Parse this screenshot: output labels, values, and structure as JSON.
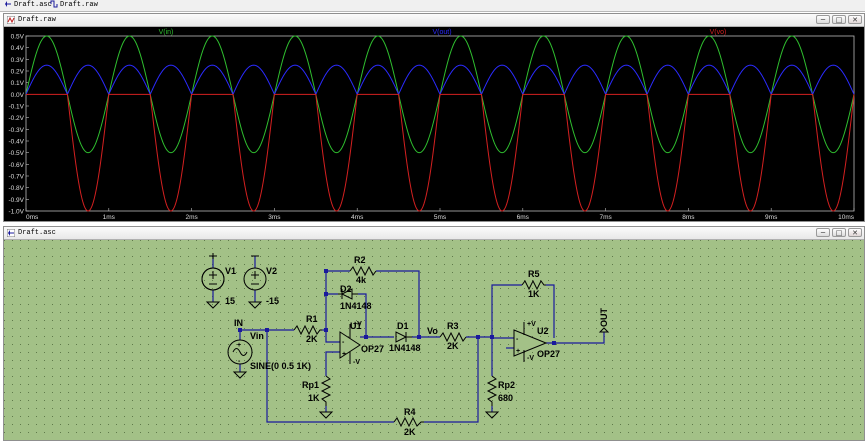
{
  "tabs": [
    {
      "label": "Draft.asc"
    },
    {
      "label": "Draft.raw"
    }
  ],
  "waveform_window": {
    "title": "Draft.raw",
    "buttons": {
      "minimize": "─",
      "restore": "□",
      "close": "✕"
    }
  },
  "schematic_window": {
    "title": "Draft.asc",
    "buttons": {
      "minimize": "─",
      "restore": "□",
      "close": "✕"
    }
  },
  "colors": {
    "plot_bg": "#000000",
    "vin": "#2fbf2f",
    "vout": "#2b2bff",
    "vo": "#d42020",
    "schematic_bg": "#a3c187",
    "wire": "#1a1a9c",
    "component": "#000000"
  },
  "chart_data": {
    "type": "line",
    "x_ticks": [
      "0ms",
      "1ms",
      "2ms",
      "3ms",
      "4ms",
      "5ms",
      "6ms",
      "7ms",
      "8ms",
      "9ms",
      "10ms"
    ],
    "y_ticks": [
      "0.5V",
      "0.4V",
      "0.3V",
      "0.2V",
      "0.1V",
      "0.0V",
      "-0.1V",
      "-0.2V",
      "-0.3V",
      "-0.4V",
      "-0.5V",
      "-0.6V",
      "-0.7V",
      "-0.8V",
      "-0.9V",
      "-1.0V"
    ],
    "xlim": [
      0,
      10
    ],
    "ylim": [
      -1.0,
      0.5
    ],
    "grid": false,
    "series": [
      {
        "name": "V(in)",
        "label": "V(in)",
        "shape": "sine",
        "frequency_khz": 1,
        "amplitude": 0.5,
        "offset": 0
      },
      {
        "name": "V(out)",
        "label": "V(out)",
        "shape": "abs_half_sine",
        "frequency_khz": 1,
        "amplitude": 0.25,
        "offset": 0
      },
      {
        "name": "V(vo)",
        "label": "V(vo)",
        "shape": "neg_half_sine",
        "frequency_khz": 1,
        "amplitude": 1.0,
        "offset": 0
      }
    ]
  },
  "schematic": {
    "labels": {
      "in": "IN",
      "vo": "Vo",
      "out": "OUT",
      "v1": "V1",
      "v1_val": "15",
      "v2": "V2",
      "v2_val": "-15",
      "vin": "Vin",
      "vin_val": "SINE(0 0.5 1K)",
      "r1": "R1",
      "r1_val": "2K",
      "r2": "R2",
      "r2_val": "4k",
      "d2": "D2",
      "d2_val": "1N4148",
      "u1": "U1",
      "u1_val": "OP27",
      "d1": "D1",
      "d1_val": "1N4148",
      "r3": "R3",
      "r3_val": "2K",
      "r4": "R4",
      "r4_val": "2K",
      "r5": "R5",
      "r5_val": "1K",
      "u2": "U2",
      "u2_val": "OP27",
      "rp1": "Rp1",
      "rp1_val": "1K",
      "rp2": "Rp2",
      "rp2_val": "680",
      "plus": "+",
      "minus": "-",
      "vplus": "+V",
      "vminus": "-V"
    }
  }
}
